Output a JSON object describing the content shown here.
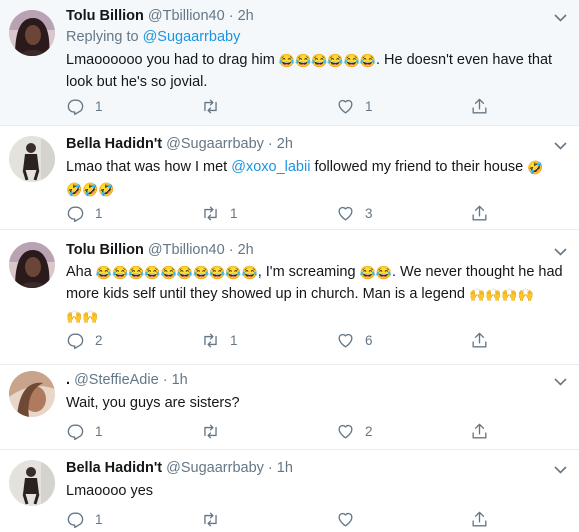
{
  "tweets": [
    {
      "name": "Tolu Billion",
      "handle": "@Tbillion40",
      "dot": "·",
      "time": "2h",
      "replying_label": "Replying to",
      "replying_handle": "@Sugaarrbaby",
      "text_a": "Lmaoooooo you had to drag him",
      "emoji_a": "😂😂😂😂😂😂",
      "text_b": ". He doesn't even have that look but he's so jovial.",
      "replies": "1",
      "retweets": "",
      "likes": "1"
    },
    {
      "name": "Bella Hadidn't",
      "handle": "@Sugaarrbaby",
      "dot": "·",
      "time": "2h",
      "text_a": "Lmao that was how I met",
      "mention": "@xoxo_labii",
      "text_b": "followed my friend to their house",
      "emoji_a": "🤣",
      "emoji_b": "🤣🤣🤣",
      "replies": "1",
      "retweets": "1",
      "likes": "3"
    },
    {
      "name": "Tolu Billion",
      "handle": "@Tbillion40",
      "dot": "·",
      "time": "2h",
      "text_a": "Aha",
      "emoji_a": "😂😂😂😂😂😂😂😂😂😂",
      "text_b": ", I'm screaming",
      "emoji_b": "😂😂",
      "text_c": ". We never thought he had more kids self until they showed up in church. Man is a legend",
      "emoji_c": "🙌🙌🙌🙌",
      "emoji_d": "🙌🙌",
      "replies": "2",
      "retweets": "1",
      "likes": "6"
    },
    {
      "name": ".",
      "handle": "@SteffieAdie",
      "dot": "·",
      "time": "1h",
      "text_a": "Wait, you guys are sisters?",
      "replies": "1",
      "retweets": "",
      "likes": "2"
    },
    {
      "name": "Bella Hadidn't",
      "handle": "@Sugaarrbaby",
      "dot": "·",
      "time": "1h",
      "text_a": "Lmaoooo yes",
      "replies": "1",
      "retweets": "",
      "likes": ""
    }
  ],
  "colors": {
    "name": "#14171a",
    "muted": "#657786",
    "link": "#1b95e0",
    "divider": "#e6ecf0",
    "shaded_bg": "#f5f8fa"
  },
  "icons": {
    "reply": "reply-icon",
    "retweet": "retweet-icon",
    "like": "heart-icon",
    "share": "share-icon",
    "more": "chevron-down-icon"
  }
}
